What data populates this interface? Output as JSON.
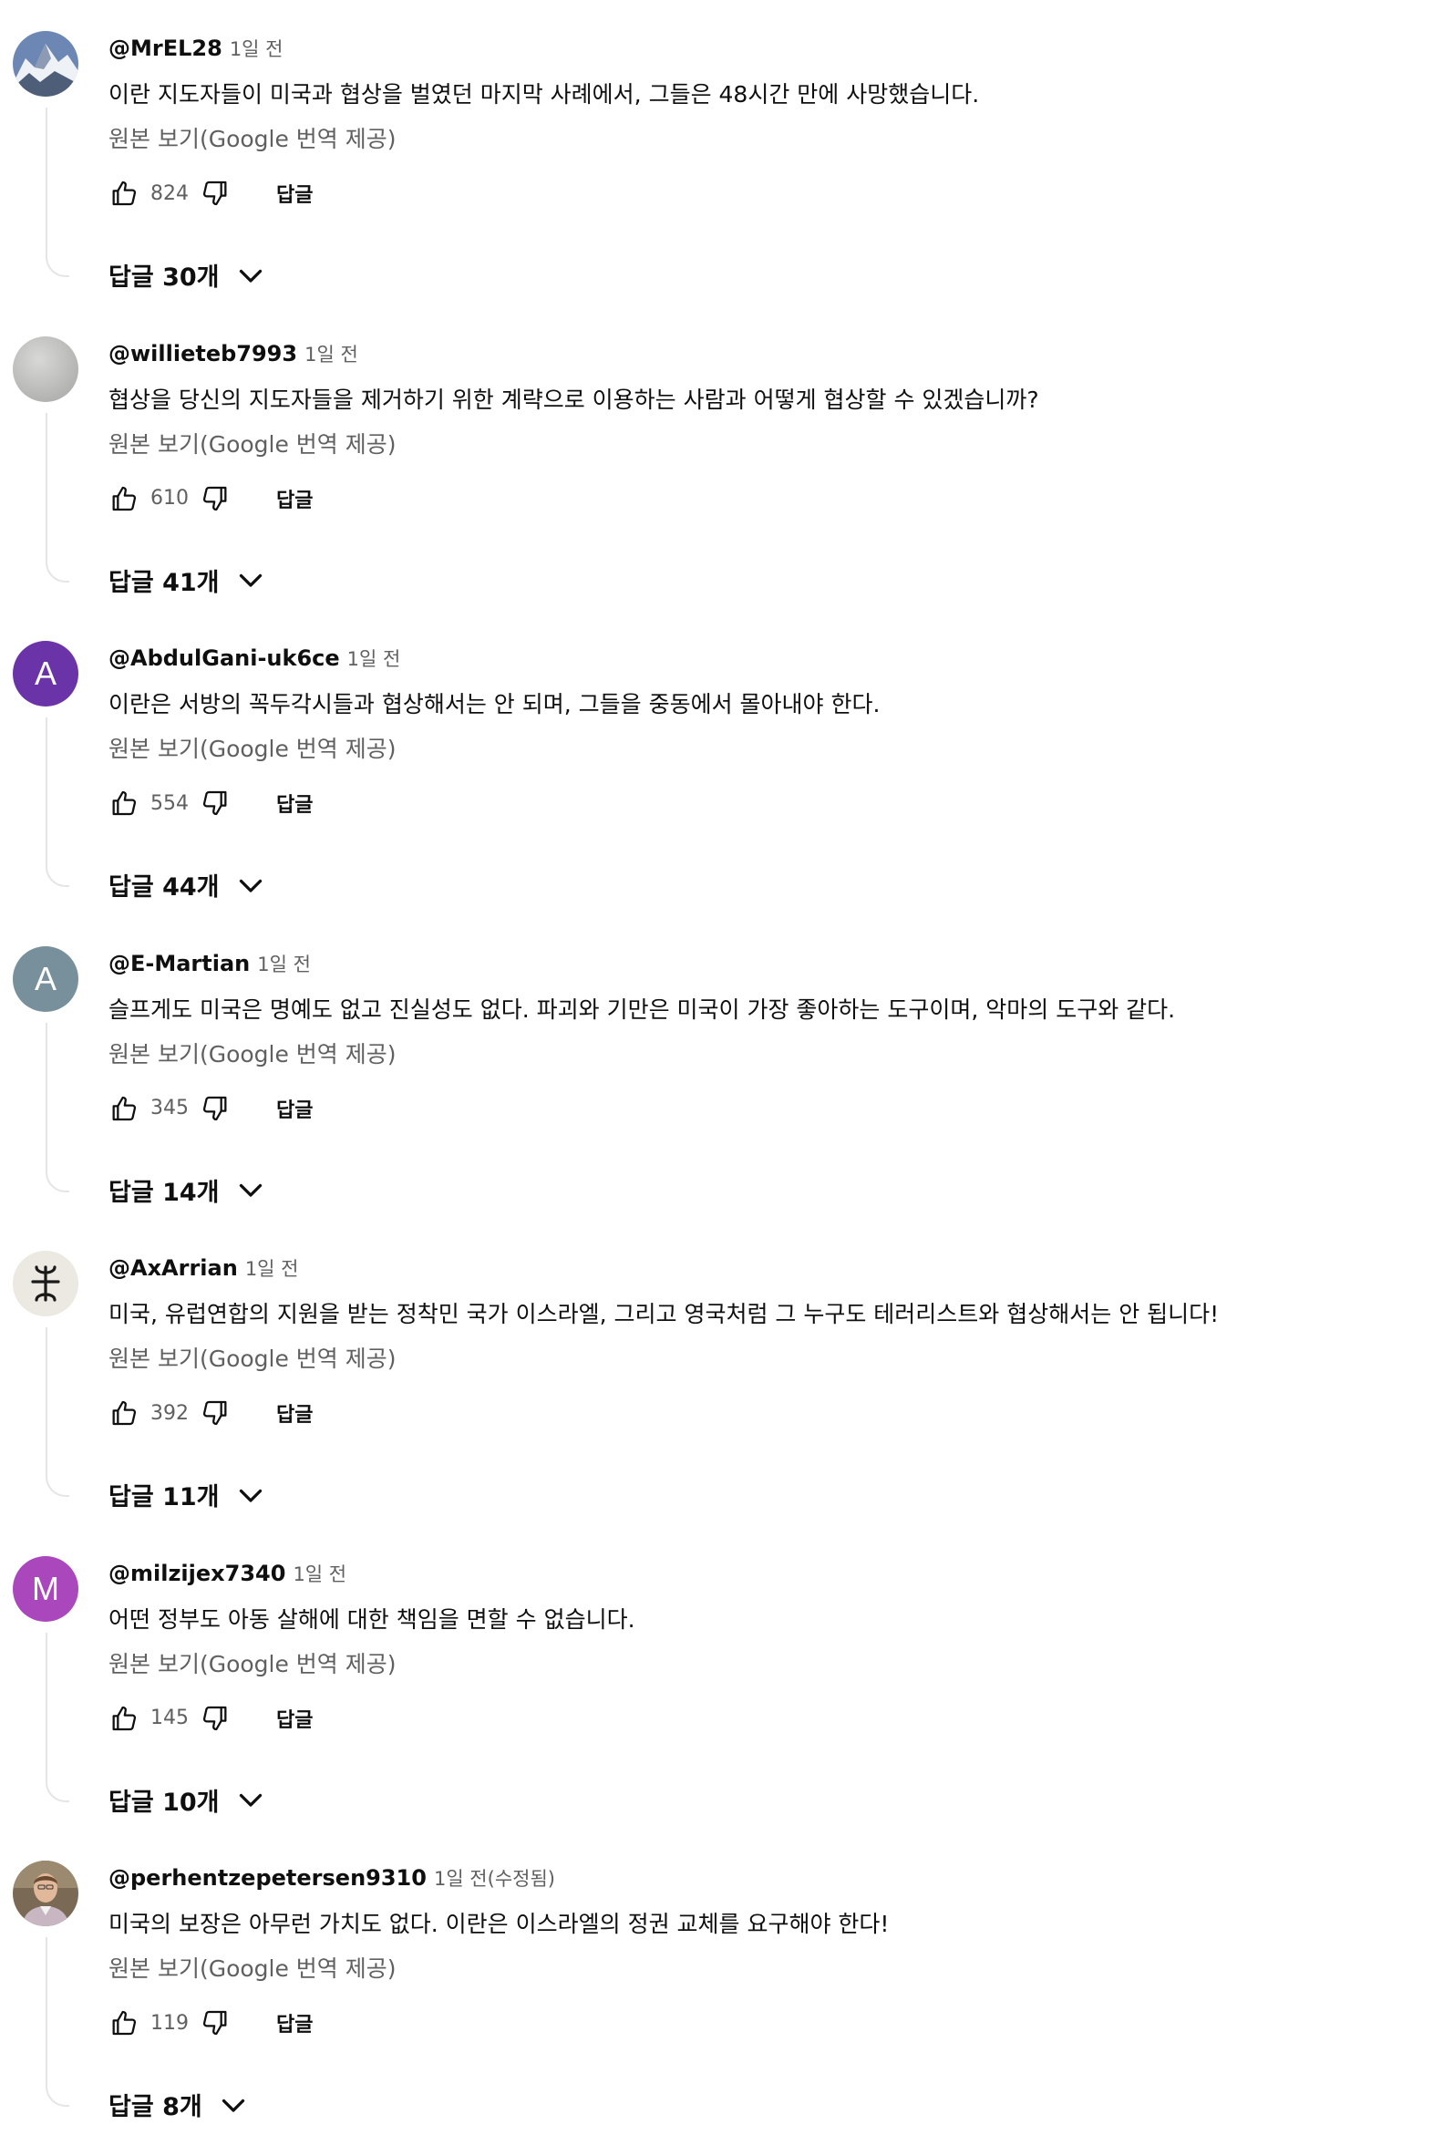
{
  "comments": [
    {
      "author": "@MrEL28",
      "time": "1일 전",
      "text": "이란 지도자들이 미국과 협상을 벌였던 마지막 사례에서, 그들은 48시간 만에 사망했습니다.",
      "translate_label": "원본 보기(Google 번역 제공)",
      "likes": "824",
      "reply_label": "답글",
      "replies_label": "답글 30개",
      "avatar": {
        "type": "image",
        "icon": "mountain-photo"
      }
    },
    {
      "author": "@willieteb7993",
      "time": "1일 전",
      "text": "협상을 당신의 지도자들을 제거하기 위한 계략으로 이용하는 사람과 어떻게 협상할 수 있겠습니까?",
      "translate_label": "원본 보기(Google 번역 제공)",
      "likes": "610",
      "reply_label": "답글",
      "replies_label": "답글 41개",
      "avatar": {
        "type": "image",
        "icon": "gray-circle"
      }
    },
    {
      "author": "@AbdulGani-uk6ce",
      "time": "1일 전",
      "text": "이란은 서방의 꼭두각시들과 협상해서는 안 되며, 그들을 중동에서 몰아내야 한다.",
      "translate_label": "원본 보기(Google 번역 제공)",
      "likes": "554",
      "reply_label": "답글",
      "replies_label": "답글 44개",
      "avatar": {
        "type": "letter",
        "letter": "A",
        "color": "#6a33a8"
      }
    },
    {
      "author": "@E-Martian",
      "time": "1일 전",
      "text": "슬프게도 미국은 명예도 없고 진실성도 없다. 파괴와 기만은 미국이 가장 좋아하는 도구이며, 악마의 도구와 같다.",
      "translate_label": "원본 보기(Google 번역 제공)",
      "likes": "345",
      "reply_label": "답글",
      "replies_label": "답글 14개",
      "avatar": {
        "type": "letter",
        "letter": "A",
        "color": "#78909c"
      }
    },
    {
      "author": "@AxArrian",
      "time": "1일 전",
      "text": "미국, 유럽연합의 지원을 받는 정착민 국가 이스라엘, 그리고 영국처럼 그 누구도 테러리스트와 협상해서는 안 됩니다!",
      "translate_label": "원본 보기(Google 번역 제공)",
      "likes": "392",
      "reply_label": "답글",
      "replies_label": "답글 11개",
      "avatar": {
        "type": "image",
        "icon": "amazigh-symbol"
      }
    },
    {
      "author": "@milzijex7340",
      "time": "1일 전",
      "text": "어떤 정부도 아동 살해에 대한 책임을 면할 수 없습니다.",
      "translate_label": "원본 보기(Google 번역 제공)",
      "likes": "145",
      "reply_label": "답글",
      "replies_label": "답글 10개",
      "avatar": {
        "type": "letter",
        "letter": "M",
        "color": "#ab47bc"
      }
    },
    {
      "author": "@perhentzepetersen9310",
      "time": "1일 전(수정됨)",
      "text": "미국의 보장은 아무런 가치도 없다. 이란은 이스라엘의 정권 교체를 요구해야 한다!",
      "translate_label": "원본 보기(Google 번역 제공)",
      "likes": "119",
      "reply_label": "답글",
      "replies_label": "답글 8개",
      "avatar": {
        "type": "image",
        "icon": "person-photo"
      }
    }
  ]
}
